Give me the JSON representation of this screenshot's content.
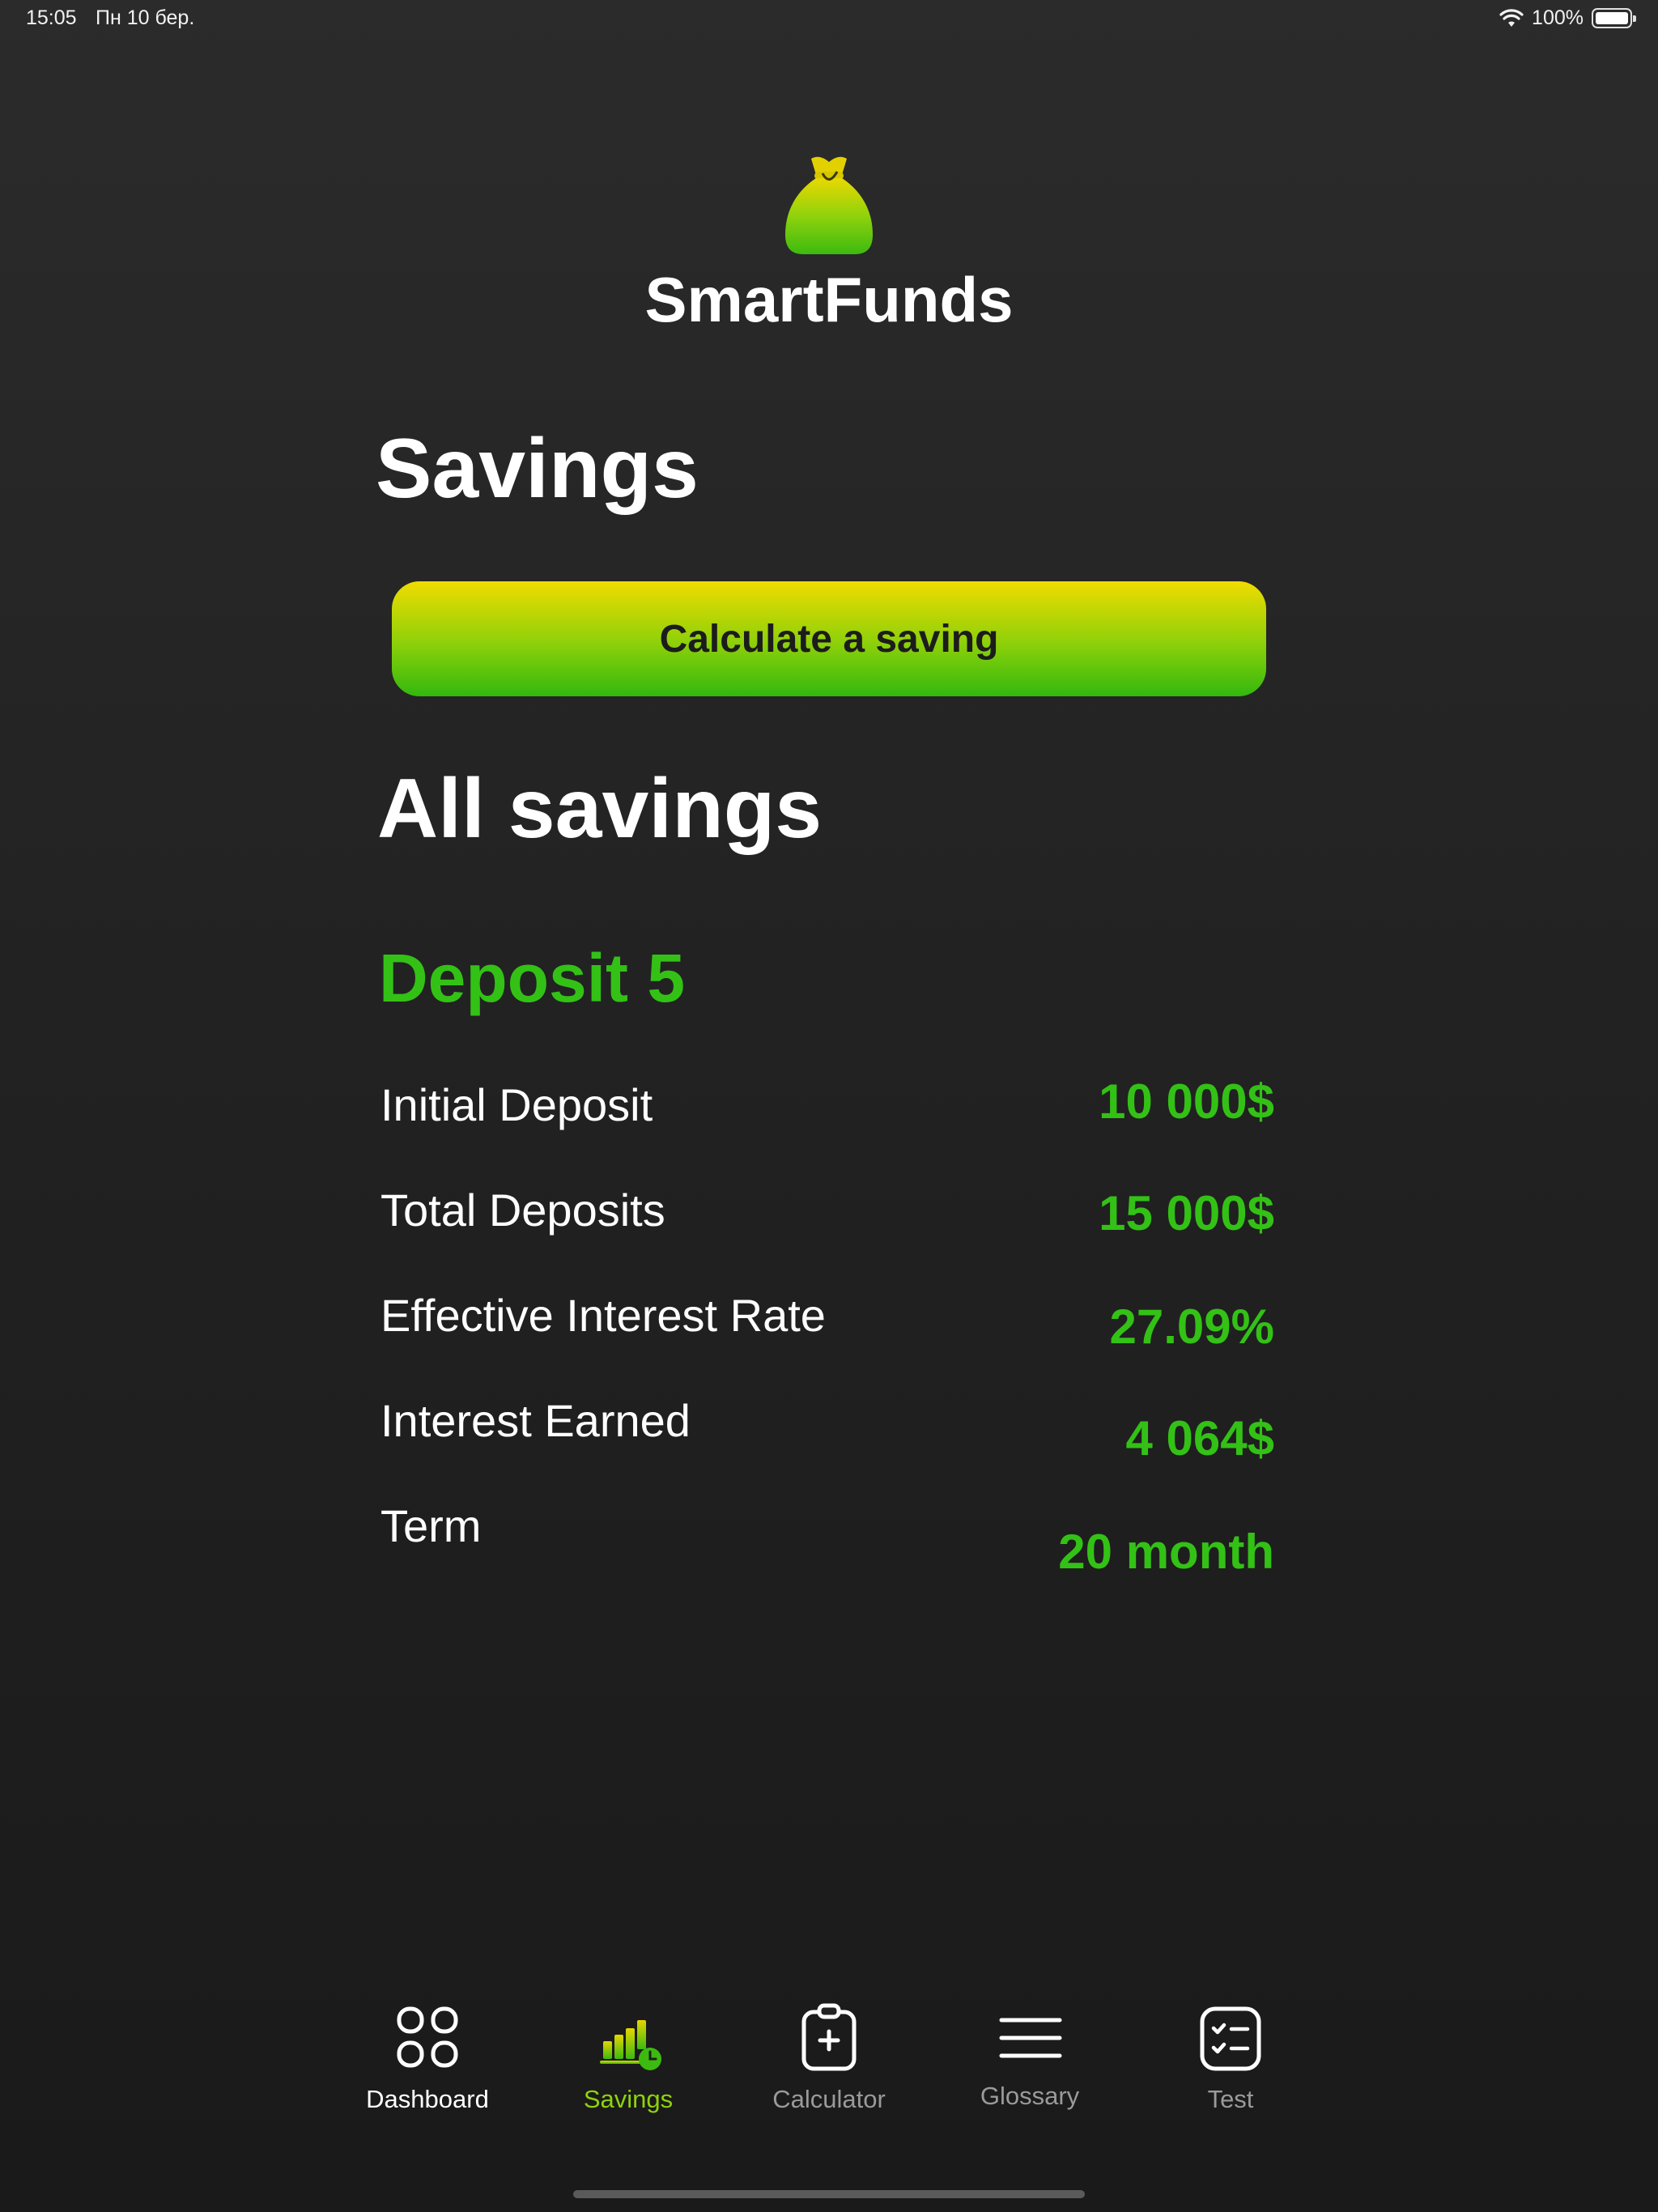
{
  "status": {
    "time": "15:05",
    "date": "Пн 10 бер.",
    "battery_percent": "100%",
    "battery_level": 1.0
  },
  "app": {
    "logo_icon": "money-bag-icon",
    "title": "SmartFunds"
  },
  "page": {
    "title": "Savings",
    "calculate_button": "Calculate a saving",
    "section_title": "All savings"
  },
  "deposit": {
    "name": "Deposit 5",
    "rows": [
      {
        "label": "Initial Deposit",
        "value": "10 000$"
      },
      {
        "label": "Total Deposits",
        "value": "15 000$"
      },
      {
        "label": "Effective Interest Rate",
        "value": "27.09%"
      },
      {
        "label": "Interest Earned",
        "value": "4 064$"
      },
      {
        "label": "Term",
        "value": "20 month"
      }
    ]
  },
  "tabs": [
    {
      "label": "Dashboard",
      "icon": "grid-icon",
      "state": "default"
    },
    {
      "label": "Savings",
      "icon": "savings-chart-icon",
      "state": "selected"
    },
    {
      "label": "Calculator",
      "icon": "clipboard-plus-icon",
      "state": "dimmed"
    },
    {
      "label": "Glossary",
      "icon": "menu-lines-icon",
      "state": "dimmed"
    },
    {
      "label": "Test",
      "icon": "checklist-icon",
      "state": "dimmed"
    }
  ],
  "colors": {
    "accent_green": "#33c116",
    "gradient_top": "#f0dc00",
    "gradient_bottom": "#33b80e",
    "dimmed_text": "#9a9a9a"
  }
}
